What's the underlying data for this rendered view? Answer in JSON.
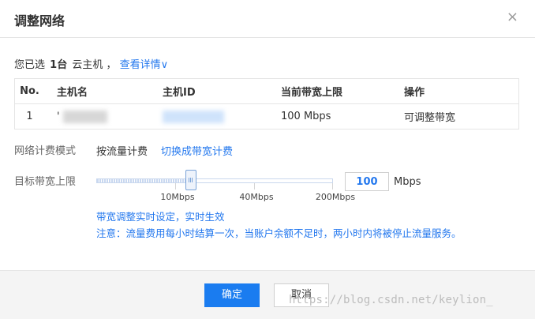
{
  "dialog": {
    "title": "调整网络",
    "close_glyph": "×"
  },
  "selection": {
    "prefix": "您已选",
    "count": "1台",
    "suffix": "云主机 ，",
    "details_link": "查看详情",
    "details_chevron": "∨"
  },
  "table": {
    "headers": [
      "No.",
      "主机名",
      "主机ID",
      "当前带宽上限",
      "操作"
    ],
    "rows": [
      {
        "no": "1",
        "name": "'",
        "id": "",
        "bandwidth": "100 Mbps",
        "action": "可调整带宽"
      }
    ]
  },
  "billing": {
    "label": "网络计费模式",
    "value": "按流量计费",
    "switch_link": "切换成带宽计费"
  },
  "bandwidth": {
    "label": "目标带宽上限",
    "value": "100",
    "unit": "Mbps",
    "slider_fraction": 0.5,
    "ticks": [
      "10Mbps",
      "40Mbps",
      "200Mbps"
    ]
  },
  "notes": {
    "line1": "带宽调整实时设定，实时生效",
    "line2": "注意：流量费用每小时结算一次，当账户余额不足时，两小时内将被停止流量服务。"
  },
  "footer": {
    "ok": "确定",
    "cancel": "取消",
    "watermark": "https://blog.csdn.net/keylion_"
  },
  "colors": {
    "accent": "#1a7cf0",
    "link": "#2277ee"
  }
}
